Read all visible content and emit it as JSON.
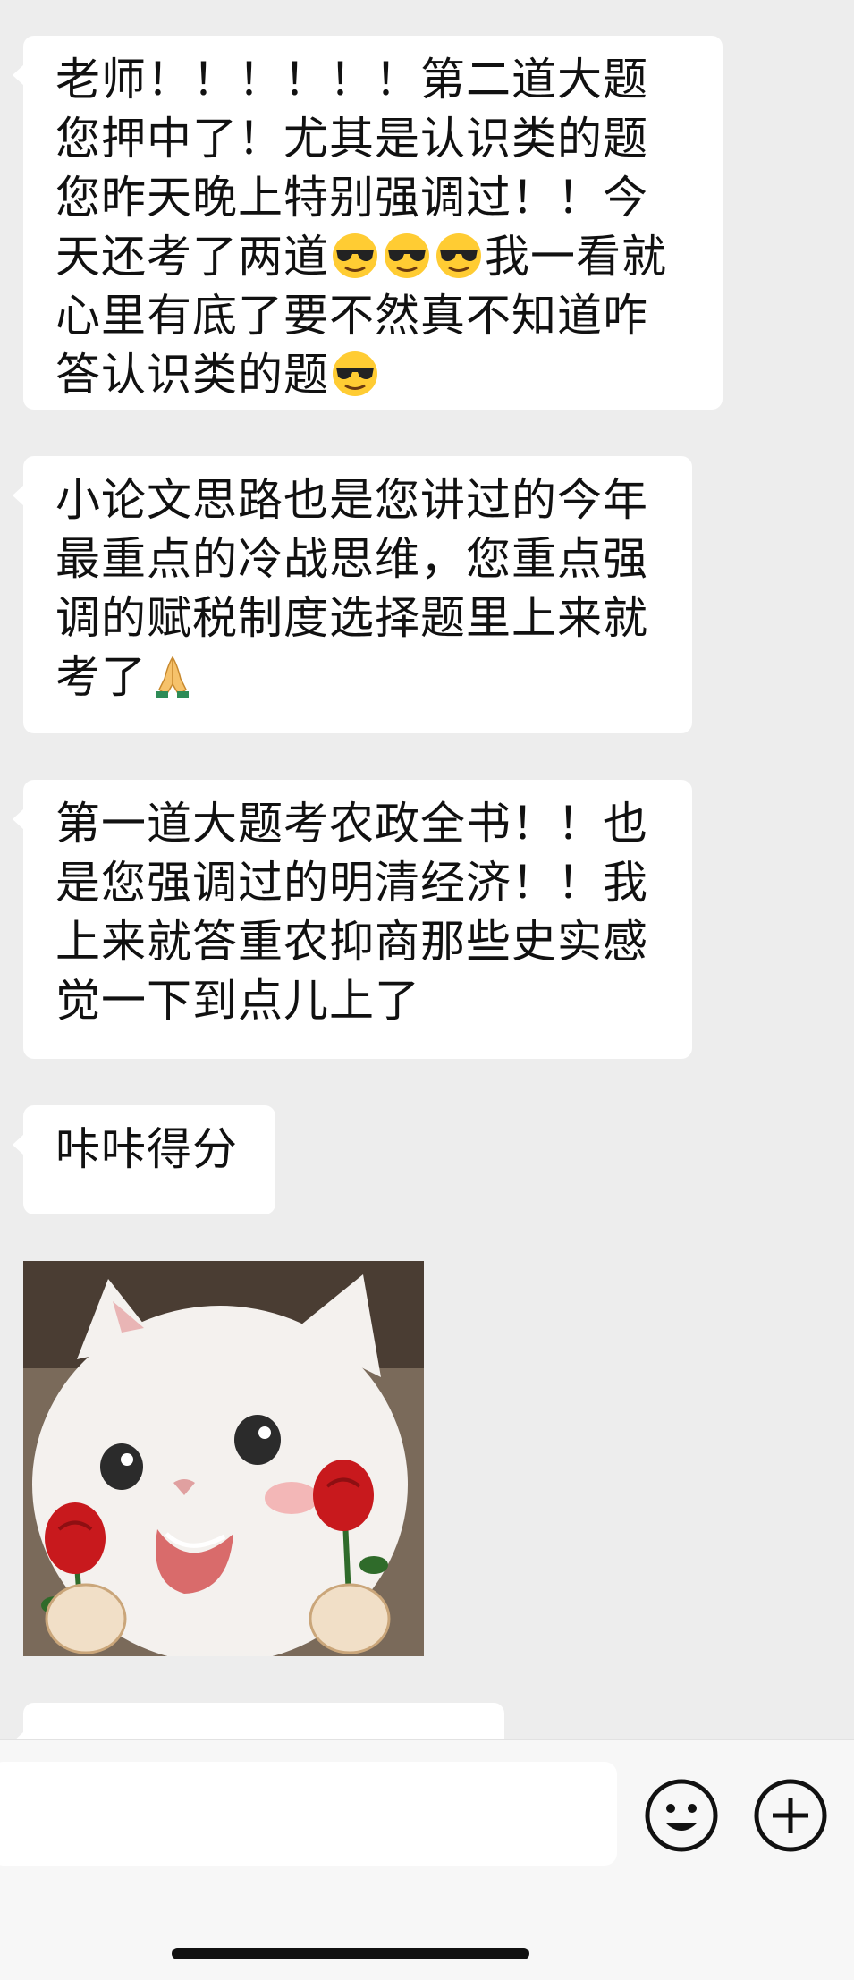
{
  "messages": [
    {
      "segments": [
        "老师！！！！！！第二道大题您押中了！尤其是认识类的题您昨天晚上特别强调过！！今天还考了两道",
        "我一看就心里有底了要不然真不知道咋答认识类的题"
      ]
    },
    {
      "segments": [
        "小论文思路也是您讲过的今年最重点的冷战思维，您重点强调的赋税制度选择题里上来就考了"
      ]
    },
    {
      "segments": [
        "第一道大题考农政全书！！也是您强调过的明清经济！！我上来就答重农抑商那些史实感觉一下到点儿上了"
      ]
    },
    {
      "segments": [
        "咔咔得分"
      ]
    }
  ],
  "emoji_names": {
    "cool": "smiling-face-with-sunglasses",
    "pray": "folded-hands"
  },
  "sticker": {
    "icon": "kitten-holding-roses-sticker"
  },
  "input": {
    "placeholder": ""
  },
  "toolbar": {
    "emoji_icon": "smiley-face-icon",
    "plus_icon": "plus-circle-icon"
  },
  "colors": {
    "background": "#ededed",
    "bubble": "#ffffff",
    "text": "#111111"
  }
}
